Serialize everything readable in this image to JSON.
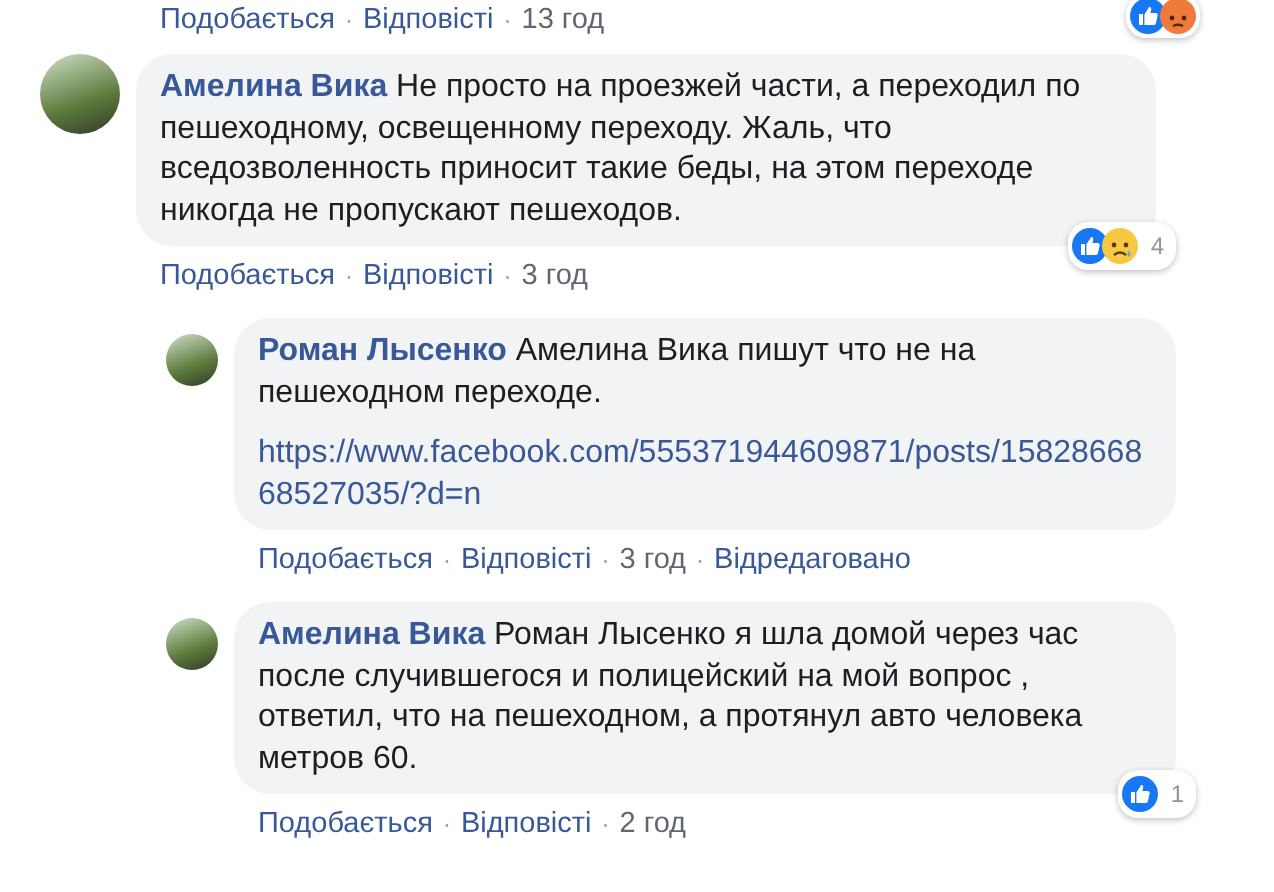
{
  "previous_comment_footer": {
    "items": [
      {
        "kind": "link",
        "text": "Подобається"
      },
      {
        "kind": "separator",
        "text": "·"
      },
      {
        "kind": "link",
        "text": "Відповісті"
      },
      {
        "kind": "separator",
        "text": "·"
      },
      {
        "kind": "meta",
        "text": "13 год"
      }
    ],
    "reactions": [
      {
        "kind": "like"
      },
      {
        "kind": "angry"
      }
    ]
  },
  "comment": {
    "author": "Амелина Вика",
    "text": "Не просто на проезжей части, а переходил по пешеходному, освещенному переходу. Жаль, что вседозволенность приносит такие беды, на этом переходе никогда не пропускают пешеходов.",
    "footer": [
      {
        "kind": "link",
        "text": "Подобається"
      },
      {
        "kind": "separator",
        "text": "·"
      },
      {
        "kind": "link",
        "text": "Відповісті"
      },
      {
        "kind": "separator",
        "text": "·"
      },
      {
        "kind": "meta",
        "text": "3 год"
      }
    ],
    "reactions": [
      {
        "kind": "like"
      },
      {
        "kind": "sad"
      }
    ],
    "reaction_count": "4",
    "replies": [
      {
        "author": "Роман Лысенко",
        "text": "Амелина Вика пишут что не на пешеходном переходе.",
        "link": "https://www.facebook.com/555371944609871/posts/1582866868527035/?d=n",
        "footer": [
          {
            "kind": "link",
            "text": "Подобається"
          },
          {
            "kind": "separator",
            "text": "·"
          },
          {
            "kind": "link",
            "text": "Відповісті"
          },
          {
            "kind": "separator",
            "text": "·"
          },
          {
            "kind": "meta",
            "text": "3 год"
          },
          {
            "kind": "separator",
            "text": "·"
          },
          {
            "kind": "link",
            "text": "Відредаговано"
          }
        ]
      },
      {
        "author": "Амелина Вика",
        "text": "Роман Лысенко я шла домой через час после случившегося и полицейский на мой вопрос , ответил, что на пешеходном, а протянул авто человека метров 60.",
        "footer": [
          {
            "kind": "link",
            "text": "Подобається"
          },
          {
            "kind": "separator",
            "text": "·"
          },
          {
            "kind": "link",
            "text": "Відповісті"
          },
          {
            "kind": "separator",
            "text": "·"
          },
          {
            "kind": "meta",
            "text": "2 год"
          }
        ],
        "reactions": [
          {
            "kind": "like"
          }
        ],
        "reaction_count": "1"
      }
    ]
  }
}
